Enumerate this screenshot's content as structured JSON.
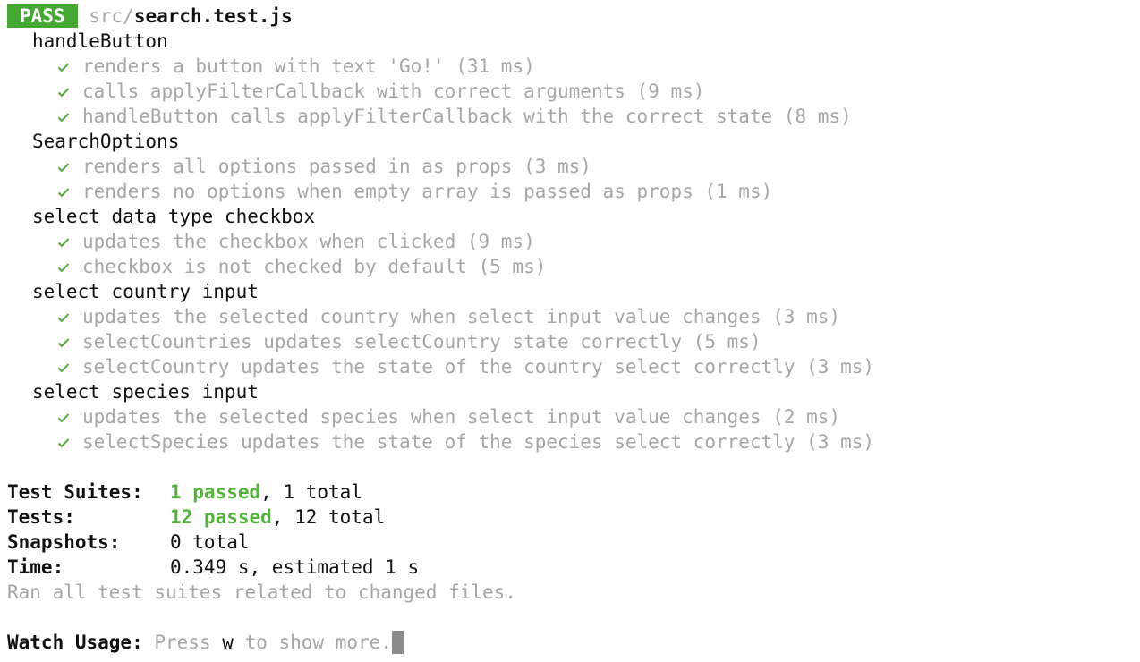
{
  "header": {
    "badge": "PASS",
    "file_dir": "src/",
    "file_name": "search.test.js"
  },
  "suites": [
    {
      "name": "handleButton",
      "tests": [
        "renders a button with text 'Go!' (31 ms)",
        "calls applyFilterCallback with correct arguments (9 ms)",
        "handleButton calls applyFilterCallback with the correct state (8 ms)"
      ]
    },
    {
      "name": "SearchOptions",
      "tests": [
        "renders all options passed in as props (3 ms)",
        "renders no options when empty array is passed as props (1 ms)"
      ]
    },
    {
      "name": "select data type checkbox",
      "tests": [
        "updates the checkbox when clicked (9 ms)",
        "checkbox is not checked by default (5 ms)"
      ]
    },
    {
      "name": "select country input",
      "tests": [
        "updates the selected country when select input value changes (3 ms)",
        "selectCountries updates selectCountry state correctly (5 ms)",
        "selectCountry updates the state of the country select correctly (3 ms)"
      ]
    },
    {
      "name": "select species input",
      "tests": [
        "updates the selected species when select input value changes (2 ms)",
        "selectSpecies updates the state of the species select correctly (3 ms)"
      ]
    }
  ],
  "summary": {
    "suites_label": "Test Suites:",
    "suites_passed": "1 passed",
    "suites_rest": ", 1 total",
    "tests_label": "Tests:",
    "tests_passed": "12 passed",
    "tests_rest": ", 12 total",
    "snapshots_label": "Snapshots:",
    "snapshots_value": "0 total",
    "time_label": "Time:",
    "time_value": "0.349 s, estimated 1 s",
    "ran_note": "Ran all test suites related to changed files."
  },
  "watch": {
    "label": "Watch Usage:",
    "press": "Press",
    "key": "w",
    "rest": "to show more."
  },
  "colors": {
    "pass_badge": "#44a832",
    "check": "#52a83a",
    "passed_text": "#52b33a",
    "muted": "#a6a6a6"
  }
}
